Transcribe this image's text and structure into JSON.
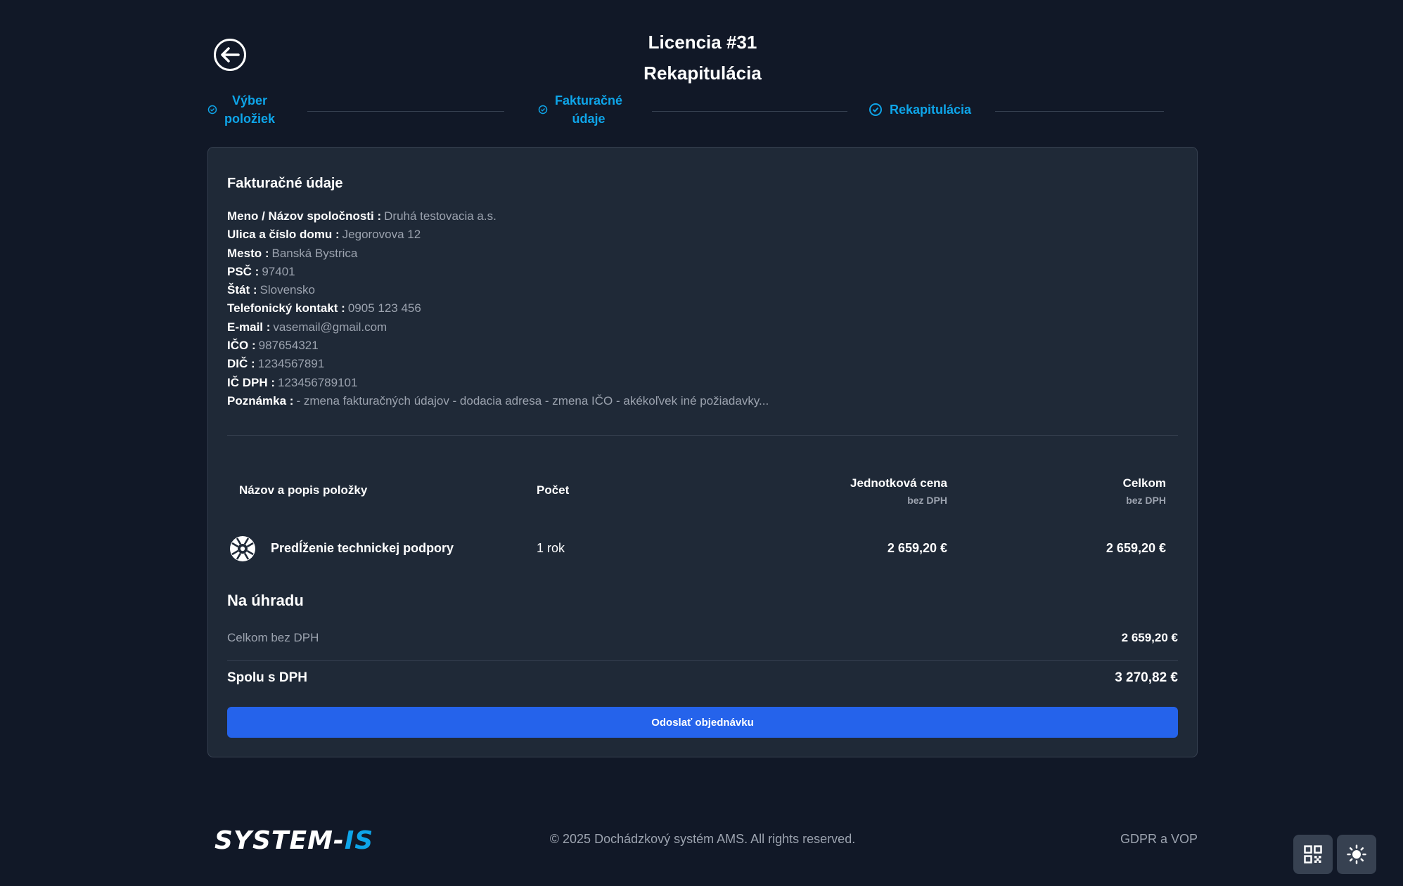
{
  "header": {
    "title": "Licencia #31",
    "subtitle": "Rekapitulácia"
  },
  "steps": [
    {
      "label_line1": "Výber",
      "label_line2": "položiek"
    },
    {
      "label_line1": "Fakturačné",
      "label_line2": "údaje"
    },
    {
      "label_line1": "Rekapitulácia",
      "label_line2": ""
    }
  ],
  "billing": {
    "title": "Fakturačné údaje",
    "fields": [
      {
        "key": "Meno / Názov spoločnosti :",
        "value": "Druhá testovacia a.s."
      },
      {
        "key": "Ulica a číslo domu :",
        "value": "Jegorovova 12"
      },
      {
        "key": "Mesto :",
        "value": "Banská Bystrica"
      },
      {
        "key": "PSČ :",
        "value": "97401"
      },
      {
        "key": "Štát :",
        "value": "Slovensko"
      },
      {
        "key": "Telefonický kontakt :",
        "value": "0905 123 456"
      },
      {
        "key": "E-mail :",
        "value": "vasemail@gmail.com"
      },
      {
        "key": "IČO :",
        "value": "987654321"
      },
      {
        "key": "DIČ :",
        "value": "1234567891"
      },
      {
        "key": "IČ DPH :",
        "value": "123456789101"
      },
      {
        "key": "Poznámka :",
        "value": "- zmena fakturačných údajov - dodacia adresa - zmena IČO - akékoľvek iné požiadavky..."
      }
    ]
  },
  "table": {
    "headers": {
      "name": "Názov a popis položky",
      "count": "Počet",
      "unit_price": "Jednotková cena",
      "unit_price_sub": "bez DPH",
      "total": "Celkom",
      "total_sub": "bez DPH"
    },
    "rows": [
      {
        "icon": "lifebuoy-icon",
        "name": "Predĺženie technickej podpory",
        "count": "1 rok",
        "unit_price": "2 659,20 €",
        "total": "2 659,20 €"
      }
    ]
  },
  "payment": {
    "title": "Na úhradu",
    "subtotal_label": "Celkom bez DPH",
    "subtotal_value": "2 659,20 €",
    "total_label": "Spolu s DPH",
    "total_value": "3 270,82 €"
  },
  "submit_label": "Odoslať objednávku",
  "footer": {
    "logo_part1": "SYSTEM-",
    "logo_part2": "IS",
    "copyright": "© 2025 Dochádzkový systém AMS. All rights reserved.",
    "gdpr": "GDPR a VOP"
  },
  "colors": {
    "background": "#111827",
    "card": "#1f2937",
    "accent": "#0ea5e9",
    "button": "#2563eb"
  }
}
